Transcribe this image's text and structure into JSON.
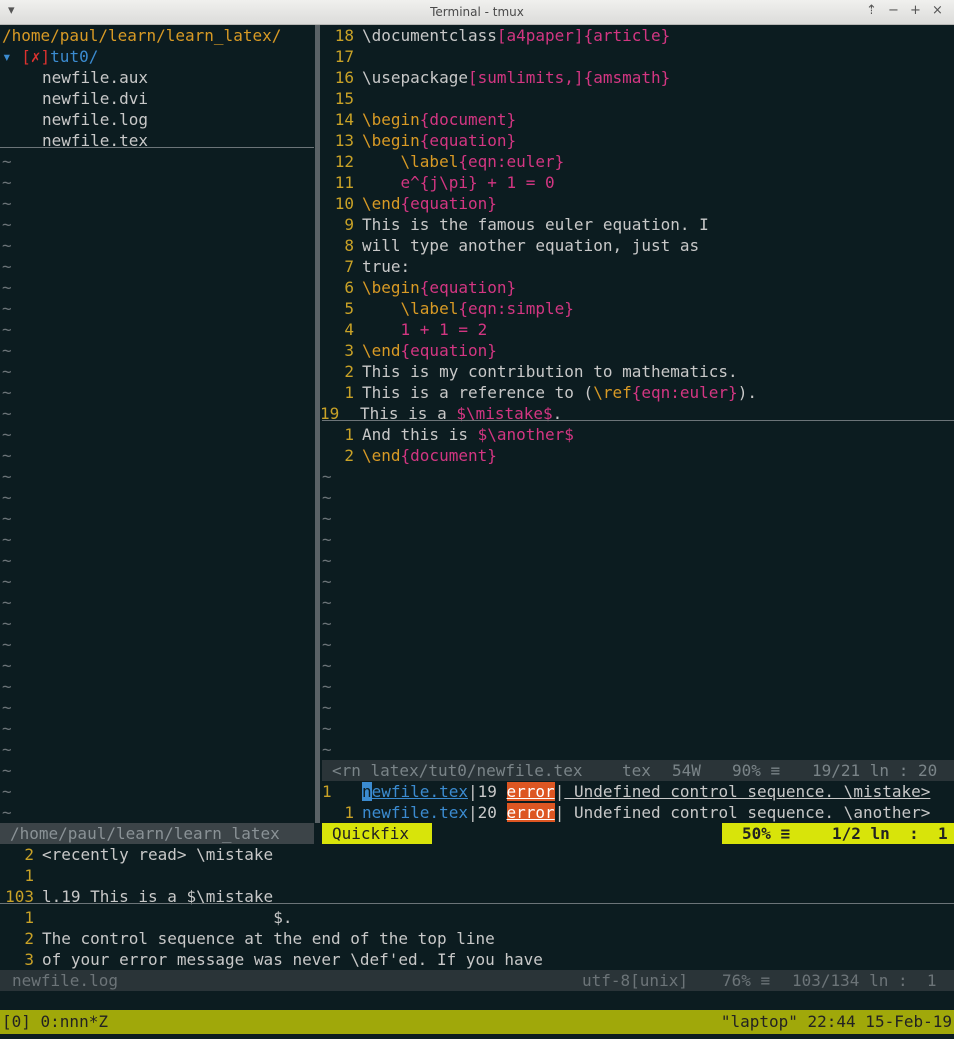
{
  "window": {
    "title": "Terminal - tmux"
  },
  "tree": {
    "root_path": "/home/paul/learn/learn_latex/",
    "folder_marker": "[✗]",
    "folder_name": "tut0/",
    "files": [
      "newfile.aux",
      "newfile.dvi",
      "newfile.log",
      "newfile.tex"
    ]
  },
  "editor": {
    "lines": [
      {
        "num": "18",
        "parts": [
          {
            "t": "\\documentclass",
            "c": "cb"
          },
          {
            "t": "[a4paper]",
            "c": "cpink"
          },
          {
            "t": "{article}",
            "c": "cpink"
          }
        ]
      },
      {
        "num": "17",
        "parts": []
      },
      {
        "num": "16",
        "parts": [
          {
            "t": "\\usepackage",
            "c": "cb"
          },
          {
            "t": "[sumlimits,]",
            "c": "cpink"
          },
          {
            "t": "{amsmath}",
            "c": "cpink"
          }
        ]
      },
      {
        "num": "15",
        "parts": []
      },
      {
        "num": "14",
        "parts": [
          {
            "t": "\\begin",
            "c": "corange"
          },
          {
            "t": "{document}",
            "c": "cpink"
          }
        ]
      },
      {
        "num": "13",
        "parts": [
          {
            "t": "\\begin",
            "c": "corange"
          },
          {
            "t": "{equation}",
            "c": "cpink"
          }
        ]
      },
      {
        "num": "12",
        "parts": [
          {
            "t": "    \\label",
            "c": "corange"
          },
          {
            "t": "{eqn:euler}",
            "c": "cpink"
          }
        ]
      },
      {
        "num": "11",
        "parts": [
          {
            "t": "    e^{j\\pi} + 1 = 0",
            "c": "cpink"
          }
        ]
      },
      {
        "num": "10",
        "parts": [
          {
            "t": "\\end",
            "c": "corange"
          },
          {
            "t": "{equation}",
            "c": "cpink"
          }
        ]
      },
      {
        "num": "9",
        "parts": [
          {
            "t": "This is the famous euler equation. I",
            "c": "cb"
          }
        ]
      },
      {
        "num": "8",
        "parts": [
          {
            "t": "will type another equation, just as",
            "c": "cb"
          }
        ]
      },
      {
        "num": "7",
        "parts": [
          {
            "t": "true:",
            "c": "cb"
          }
        ]
      },
      {
        "num": "6",
        "parts": [
          {
            "t": "\\begin",
            "c": "corange"
          },
          {
            "t": "{equation}",
            "c": "cpink"
          }
        ]
      },
      {
        "num": "5",
        "parts": [
          {
            "t": "    \\label",
            "c": "corange"
          },
          {
            "t": "{eqn:simple}",
            "c": "cpink"
          }
        ]
      },
      {
        "num": "4",
        "parts": [
          {
            "t": "    1 + 1 = 2",
            "c": "cpink"
          }
        ]
      },
      {
        "num": "3",
        "parts": [
          {
            "t": "\\end",
            "c": "corange"
          },
          {
            "t": "{equation}",
            "c": "cpink"
          }
        ]
      },
      {
        "num": "2",
        "parts": [
          {
            "t": "This is my contribution to mathematics.",
            "c": "cb"
          }
        ]
      },
      {
        "num": "1",
        "parts": [
          {
            "t": "This is a reference to (",
            "c": "cb"
          },
          {
            "t": "\\ref",
            "c": "corange"
          },
          {
            "t": "{eqn:euler}",
            "c": "cpink"
          },
          {
            "t": ").",
            "c": "cb"
          }
        ]
      },
      {
        "num": "19",
        "current": true,
        "parts": [
          {
            "t": "This is a ",
            "c": "cb"
          },
          {
            "t": "$\\mistake$",
            "c": "cpink"
          },
          {
            "t": ".",
            "c": "cb"
          }
        ]
      },
      {
        "num": "1",
        "parts": [
          {
            "t": "And this is ",
            "c": "cb"
          },
          {
            "t": "$\\another$",
            "c": "cpink"
          }
        ]
      },
      {
        "num": "2",
        "parts": [
          {
            "t": "\\end",
            "c": "corange"
          },
          {
            "t": "{document}",
            "c": "cpink"
          }
        ]
      }
    ],
    "status": {
      "file": "<rn latex/tut0/newfile.tex",
      "filetype": "tex",
      "words": "54W",
      "percent": "90% ≡",
      "position": "19/21 ln : 20"
    }
  },
  "tree_status": {
    "path": "/home/paul/learn/learn_latex"
  },
  "quickfix": {
    "items": [
      {
        "num": "1",
        "file": "newfile.tex",
        "line": "19",
        "type": "error",
        "msg": " Undefined control sequence. \\mistake>"
      },
      {
        "num": "1",
        "file": "newfile.tex",
        "line": "20",
        "type": "error",
        "msg": " Undefined control sequence. \\another>"
      }
    ],
    "label": "Quickfix",
    "percent": "50% ≡",
    "position": "1/2 ln  :  1"
  },
  "log": {
    "lines": [
      {
        "num": "2",
        "text": "<recently read> \\mistake"
      },
      {
        "num": "1",
        "text": ""
      },
      {
        "num": "103",
        "text": "l.19 This is a $\\mistake",
        "current": true
      },
      {
        "num": "1",
        "text": "                        $."
      },
      {
        "num": "2",
        "text": "The control sequence at the end of the top line"
      },
      {
        "num": "3",
        "text": "of your error message was never \\def'ed. If you have"
      }
    ],
    "status": {
      "file": "newfile.log",
      "encoding": "utf-8[unix]",
      "percent": "76% ≡",
      "position": "103/134 ln :  1"
    }
  },
  "tmux": {
    "session": "[0] 0:nnn*Z",
    "right": "\"laptop\" 22:44 15-Feb-19"
  }
}
